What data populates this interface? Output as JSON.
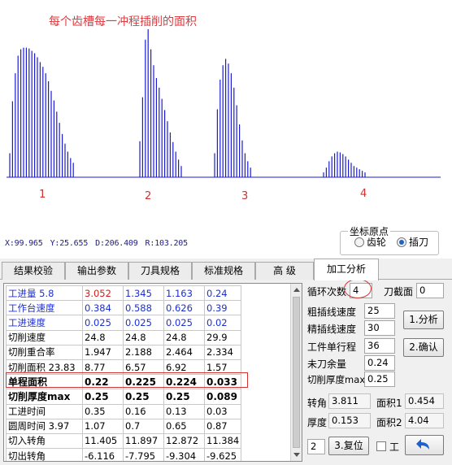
{
  "plot": {
    "title": "每个齿槽每一冲程插削的面积",
    "peak_labels": [
      "1",
      "2",
      "3",
      "4"
    ],
    "coords": {
      "x": "X:99.965",
      "y": "Y:25.655",
      "d": "D:206.409",
      "r": "R:103.205"
    },
    "line_color": "#1c1cd6",
    "chart_data": {
      "type": "bar",
      "series": [
        {
          "values": [
            0.3,
            0.95,
            1.3,
            1.52,
            1.6,
            1.62,
            1.62,
            1.61,
            1.58,
            1.55,
            1.5,
            1.44,
            1.38,
            1.3,
            1.2,
            1.08,
            0.96,
            0.82,
            0.68,
            0.54,
            0.42,
            0.32,
            0.24,
            0.18
          ]
        },
        {
          "values": [
            0.45,
            1.0,
            1.72,
            1.85,
            1.6,
            1.4,
            1.24,
            1.12,
            0.98,
            0.84,
            0.7,
            0.56,
            0.44,
            0.32,
            0.22,
            0.14
          ]
        },
        {
          "values": [
            0.3,
            0.85,
            1.22,
            1.4,
            1.48,
            1.42,
            1.3,
            1.12,
            0.9,
            0.66,
            0.46,
            0.3,
            0.2,
            0.12
          ]
        },
        {
          "values": [
            0.06,
            0.12,
            0.2,
            0.26,
            0.3,
            0.32,
            0.31,
            0.29,
            0.26,
            0.22,
            0.18,
            0.14,
            0.12,
            0.1,
            0.08,
            0.06
          ]
        }
      ]
    }
  },
  "origin": {
    "title": "坐标原点",
    "opt1": "齿轮",
    "opt2": "插刀",
    "selected": "插刀"
  },
  "tabs": [
    "结果校验",
    "输出参数",
    "刀具规格",
    "标准规格",
    "高 级",
    "加工分析"
  ],
  "active_tab": "加工分析",
  "table": {
    "rows": [
      {
        "name": "工进量 5.8",
        "blue": true,
        "cells": [
          "3.052",
          "1.345",
          "1.163",
          "0.24"
        ],
        "first_red": true
      },
      {
        "name": "工作台速度",
        "blue": true,
        "cells": [
          "0.384",
          "0.588",
          "0.626",
          "0.39"
        ]
      },
      {
        "name": "工进速度",
        "blue": true,
        "cells": [
          "0.025",
          "0.025",
          "0.025",
          "0.02"
        ]
      },
      {
        "name": "切削速度",
        "cells": [
          "24.8",
          "24.8",
          "24.8",
          "29.9"
        ]
      },
      {
        "name": "切削重合率",
        "cells": [
          "1.947",
          "2.188",
          "2.464",
          "2.334"
        ]
      },
      {
        "name": "切削面积 23.83",
        "cells": [
          "8.77",
          "6.57",
          "6.92",
          "1.57"
        ]
      },
      {
        "name": "单程面积",
        "bold": true,
        "cells": [
          "0.22",
          "0.225",
          "0.224",
          "0.033"
        ]
      },
      {
        "name": "切削厚度max",
        "bold": true,
        "cells": [
          "0.25",
          "0.25",
          "0.25",
          "0.089"
        ]
      },
      {
        "name": "工进时间",
        "cells": [
          "0.35",
          "0.16",
          "0.13",
          "0.03"
        ]
      },
      {
        "name": "圆周时间 3.97",
        "cells": [
          "1.07",
          "0.7",
          "0.65",
          "0.87"
        ]
      },
      {
        "name": "切入转角",
        "cells": [
          "11.405",
          "11.897",
          "12.872",
          "11.384"
        ]
      },
      {
        "name": "切出转角",
        "cells": [
          "-6.116",
          "-7.795",
          "-9.304",
          "-9.625"
        ]
      }
    ]
  },
  "params": {
    "cycles_label": "循环次数",
    "cycles_value": "4",
    "knife_label": "刀截面",
    "knife_value": "0",
    "rough_label": "粗插线速度",
    "rough_value": "25",
    "fine_label": "精插线速度",
    "fine_value": "30",
    "stroke_label": "工件单行程",
    "stroke_value": "36",
    "remain_label": "未刀余量",
    "remain_value": "0.24",
    "thick_label": "切削厚度max",
    "thick_value": "0.25",
    "angle_label": "转角",
    "angle_value": "3.811",
    "area1_label": "面积1",
    "area1_value": "0.454",
    "depth_label": "厚度",
    "depth_value": "0.153",
    "area2_label": "面积2",
    "area2_value": "4.04",
    "count_value": "2",
    "analyze_btn": "1.分析",
    "confirm_btn": "2.确认",
    "reset_btn": "3.复位",
    "check_label": "工",
    "undo_icon": "undo-arrow-icon"
  }
}
